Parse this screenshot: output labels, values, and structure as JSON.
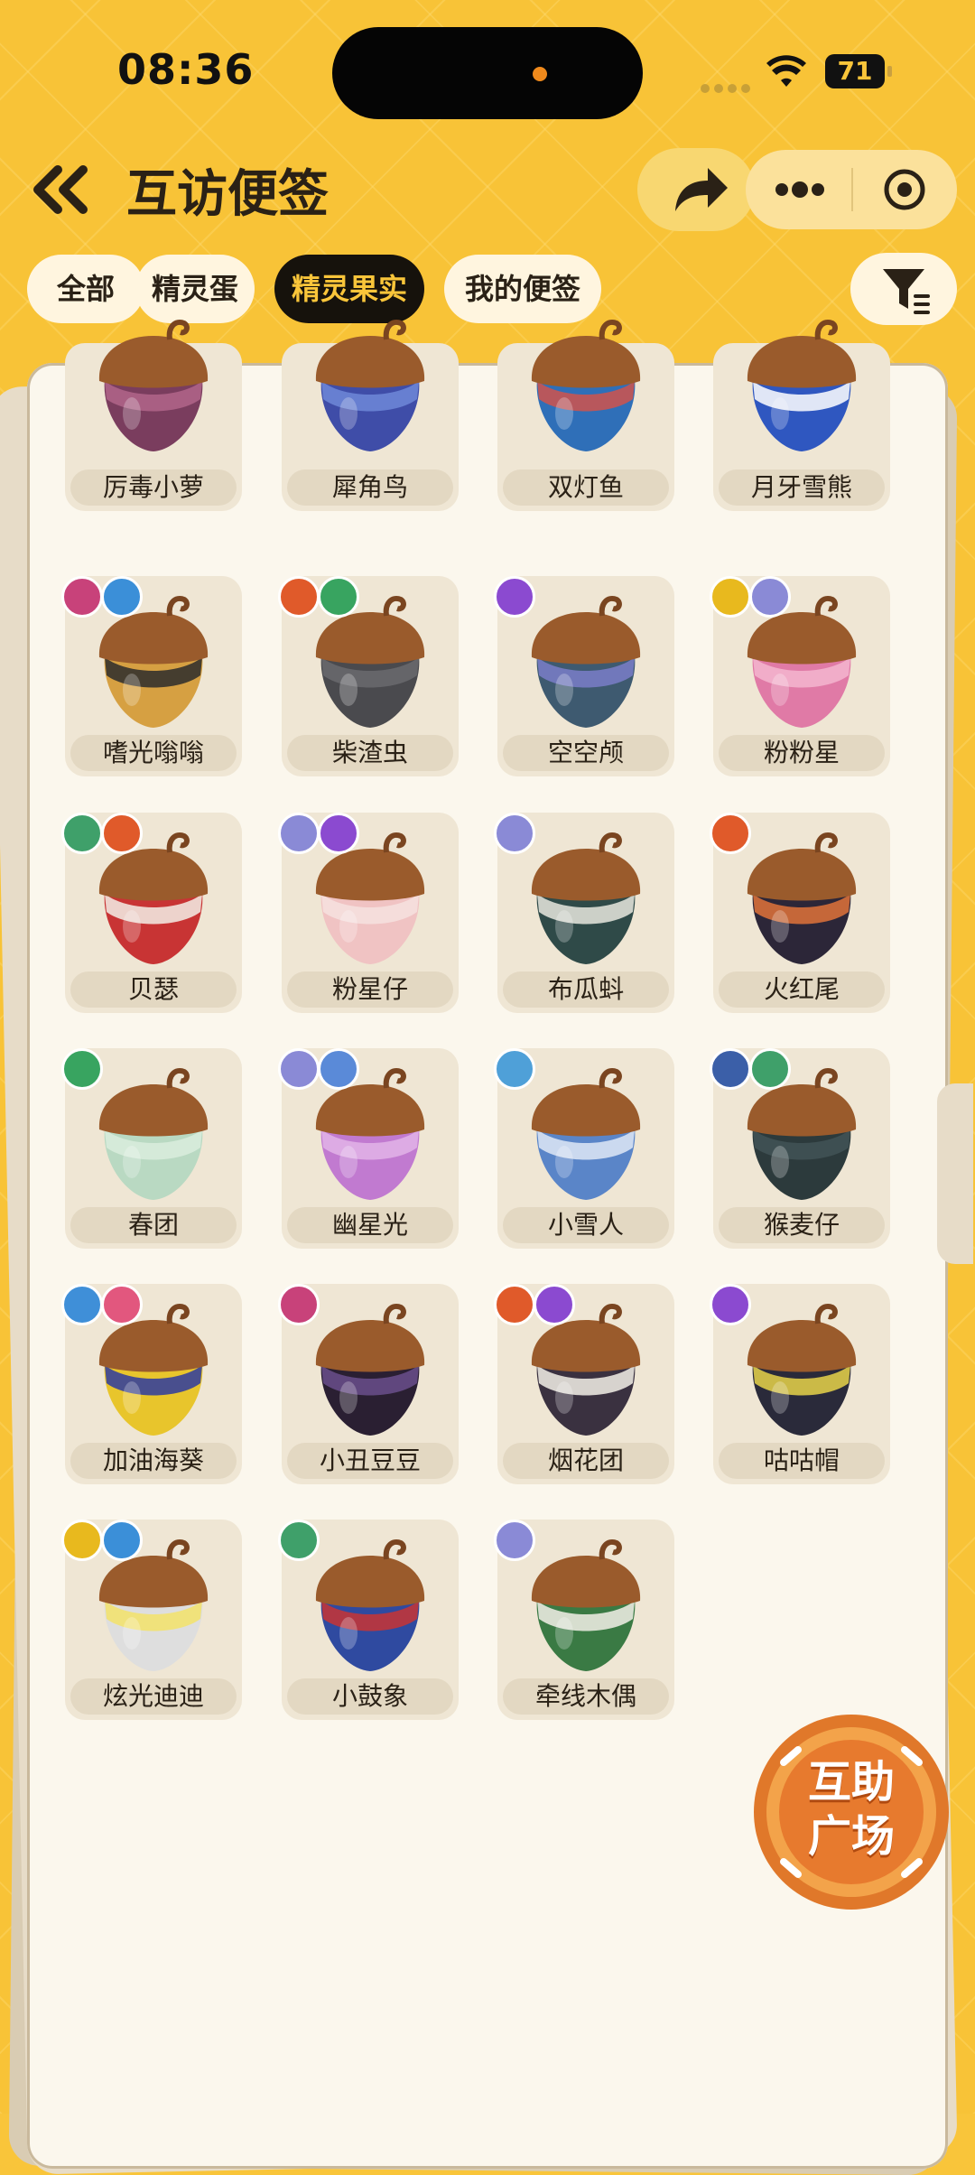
{
  "status_bar": {
    "time": "08:36",
    "battery": "71"
  },
  "header": {
    "title": "互访便签"
  },
  "tabs": [
    {
      "label": "全部",
      "active": false
    },
    {
      "label": "精灵蛋",
      "active": false
    },
    {
      "label": "精灵果实",
      "active": true
    },
    {
      "label": "我的便签",
      "active": false
    }
  ],
  "cards": [
    {
      "name": "厉毒小萝",
      "body": "#7a3d5e",
      "band": "#b1658a",
      "badges": []
    },
    {
      "name": "犀角鸟",
      "body": "#3f4da8",
      "band": "#6e88d8",
      "badges": []
    },
    {
      "name": "双灯鱼",
      "body": "#2f6fb8",
      "band": "#d0534b",
      "badges": []
    },
    {
      "name": "月牙雪熊",
      "body": "#2f57c0",
      "band": "#ffffff",
      "badges": []
    },
    {
      "name": "嗜光嗡嗡",
      "body": "#d6a042",
      "band": "#2b2b2b",
      "badges": [
        "#c8427a",
        "#3b8fd8"
      ]
    },
    {
      "name": "柴渣虫",
      "body": "#4a4a4e",
      "band": "#6a6a6e",
      "badges": [
        "#e05a2a",
        "#38a460"
      ]
    },
    {
      "name": "空空颅",
      "body": "#3e5a70",
      "band": "#7a7ec8",
      "badges": [
        "#8b4ad0"
      ]
    },
    {
      "name": "粉粉星",
      "body": "#e07aa6",
      "band": "#f3b6cf",
      "badges": [
        "#e8b91e",
        "#8a8ad6"
      ]
    },
    {
      "name": "贝瑟",
      "body": "#c83434",
      "band": "#f3f0e8",
      "badges": [
        "#3fa06a",
        "#e05a2a"
      ]
    },
    {
      "name": "粉星仔",
      "body": "#f0c3c3",
      "band": "#f6e2df",
      "badges": [
        "#8a8ad6",
        "#8b4ad0"
      ]
    },
    {
      "name": "布瓜蚪",
      "body": "#2f4a48",
      "band": "#e7e7df",
      "badges": [
        "#8a8ad6"
      ]
    },
    {
      "name": "火红尾",
      "body": "#2c2638",
      "band": "#e0733a",
      "badges": [
        "#e05a2a"
      ]
    },
    {
      "name": "春团",
      "body": "#b9d9c2",
      "band": "#d9ecdd",
      "badges": [
        "#38a460"
      ]
    },
    {
      "name": "幽星光",
      "body": "#c17ad0",
      "band": "#e2b4e8",
      "badges": [
        "#8a8ad6",
        "#5a8ad8"
      ]
    },
    {
      "name": "小雪人",
      "body": "#5a85c8",
      "band": "#dfe8f6",
      "badges": [
        "#4fa0d8"
      ]
    },
    {
      "name": "猴麦仔",
      "body": "#2c3a3c",
      "band": "#425456",
      "badges": [
        "#3b5fa8",
        "#3fa06a"
      ]
    },
    {
      "name": "加油海葵",
      "body": "#e8c52c",
      "band": "#2d3aa0",
      "badges": [
        "#3f8fd8",
        "#e2577e"
      ]
    },
    {
      "name": "小丑豆豆",
      "body": "#2a1f32",
      "band": "#6a4f8c",
      "badges": [
        "#c8427a"
      ]
    },
    {
      "name": "烟花团",
      "body": "#3a3140",
      "band": "#f3f0e8",
      "badges": [
        "#e05a2a",
        "#8b4ad0"
      ]
    },
    {
      "name": "咕咕帽",
      "body": "#2a2a3a",
      "band": "#e8d34a",
      "badges": [
        "#8b4ad0"
      ]
    },
    {
      "name": "炫光迪迪",
      "body": "#dedede",
      "band": "#f3e36a",
      "badges": [
        "#e8b91e",
        "#3b8fd8"
      ]
    },
    {
      "name": "小鼓象",
      "body": "#2f4aa0",
      "band": "#c83434",
      "badges": [
        "#3fa06a"
      ]
    },
    {
      "name": "牵线木偶",
      "body": "#3a7a44",
      "band": "#f3f0e8",
      "badges": [
        "#8a8ad6"
      ]
    }
  ],
  "helper_button": {
    "line1": "互助",
    "line2": "广场"
  }
}
